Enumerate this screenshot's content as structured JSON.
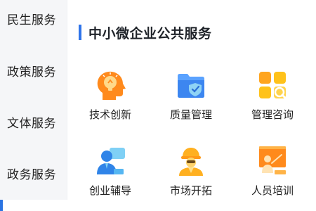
{
  "sidebar": {
    "items": [
      {
        "label": "民生服务"
      },
      {
        "label": "政策服务"
      },
      {
        "label": "文体服务"
      },
      {
        "label": "政务服务"
      },
      {
        "label": ""
      }
    ],
    "active_index": 4,
    "active_color": "#2b74e2"
  },
  "section": {
    "title": "中小微企业公共服务",
    "accent_color": "#2f74ea"
  },
  "services": [
    {
      "label": "技术创新",
      "icon": "innovation-head-icon"
    },
    {
      "label": "质量管理",
      "icon": "quality-folder-shield-icon"
    },
    {
      "label": "管理咨询",
      "icon": "consulting-grid-icon"
    },
    {
      "label": "创业辅导",
      "icon": "mentor-person-icon"
    },
    {
      "label": "市场开拓",
      "icon": "explorer-helmet-icon"
    },
    {
      "label": "人员培训",
      "icon": "training-board-icon"
    }
  ]
}
